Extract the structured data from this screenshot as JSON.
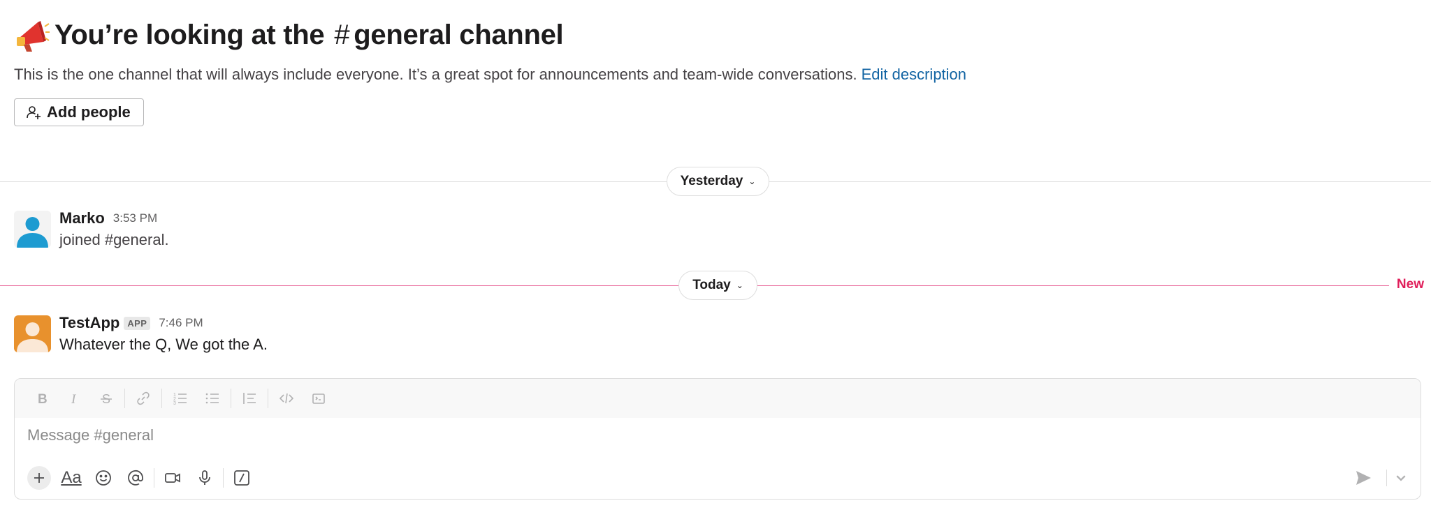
{
  "intro": {
    "title_prefix": "You’re looking at the",
    "hash": "#",
    "channel": "general channel",
    "description": "This is the one channel that will always include everyone. It’s a great spot for announcements and team-wide conversations.",
    "edit_link": "Edit description",
    "add_people": "Add people"
  },
  "dividers": {
    "yesterday": "Yesterday",
    "today": "Today",
    "new_label": "New"
  },
  "messages": [
    {
      "author": "Marko",
      "time": "3:53 PM",
      "text": "joined #general."
    },
    {
      "author": "TestApp",
      "badge": "APP",
      "time": "7:46 PM",
      "text": "Whatever the Q, We got the A."
    }
  ],
  "composer": {
    "placeholder": "Message #general",
    "aa_label": "Aa"
  },
  "icons": {
    "megaphone": "megaphone-icon",
    "add_person": "add-person-icon",
    "format": [
      "bold-icon",
      "italic-icon",
      "strikethrough-icon",
      "link-icon",
      "ordered-list-icon",
      "bulleted-list-icon",
      "blockquote-icon",
      "code-icon",
      "code-block-icon"
    ],
    "actions": [
      "plus-icon",
      "formatting-icon",
      "emoji-icon",
      "mention-icon",
      "video-icon",
      "microphone-icon",
      "shortcuts-icon"
    ],
    "send": "send-icon"
  },
  "colors": {
    "link": "#1264a3",
    "new_line": "#e8699a",
    "new_label": "#e01e5a",
    "marko_avatar": "#1d9bd1",
    "testapp_avatar": "#e8912d"
  }
}
